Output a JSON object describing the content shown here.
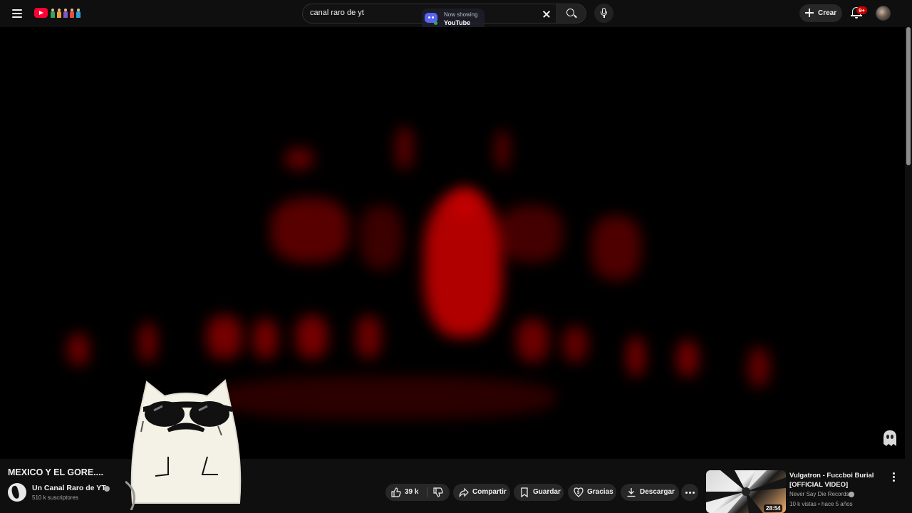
{
  "header": {
    "search_value": "canal raro de yt",
    "create_label": "Crear",
    "notifications_badge": "9+"
  },
  "overlay": {
    "now_showing_label": "Now showing",
    "now_showing_app": "YouTube"
  },
  "video": {
    "title": "MEXICO Y EL GORE....",
    "channel_name": "Un Canal Raro de YT",
    "subscribers": "510 k suscriptores",
    "scene_color": "#c40000"
  },
  "actions": {
    "likes": "39 k",
    "share": "Compartir",
    "save": "Guardar",
    "thanks": "Gracias",
    "download": "Descargar"
  },
  "recommendation": {
    "title": "Vulgatron - Fuccboi Burial [OFFICIAL VIDEO]",
    "channel": "Never Say Die Records",
    "meta": "10 k vistas • hace 5 años",
    "duration": "28:54"
  },
  "colors": {
    "background": "#0f0f0f",
    "brand_red": "#ff0033",
    "badge_red": "#cc0000",
    "pill": "#272727"
  }
}
